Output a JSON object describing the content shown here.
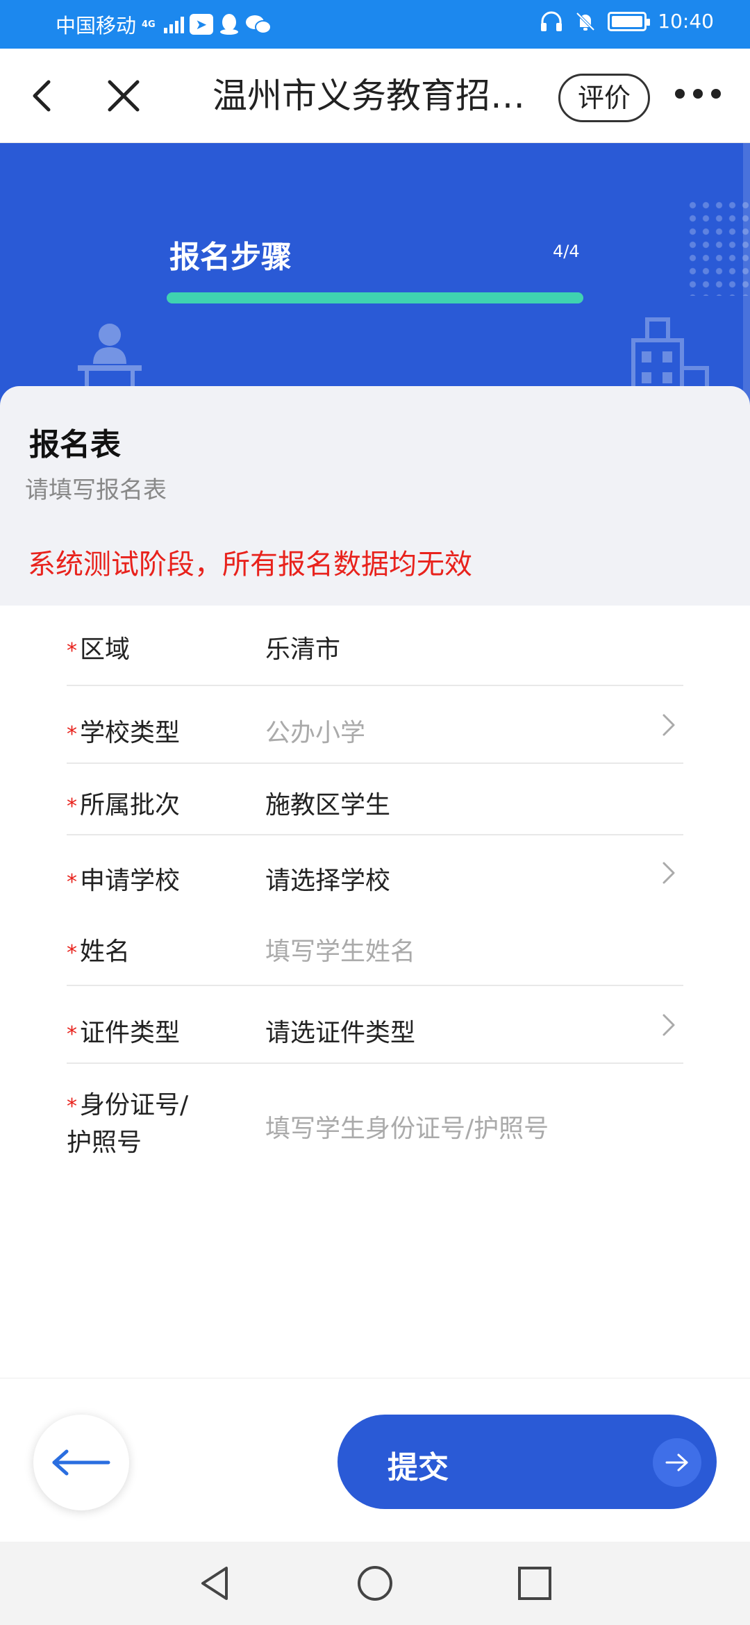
{
  "status_bar": {
    "carrier": "中国移动",
    "network": "4G",
    "time": "10:40"
  },
  "nav": {
    "title": "温州市义务教育招生报名",
    "rate_label": "评价"
  },
  "banner": {
    "step_title": "报名步骤",
    "step_count": "4/4",
    "progress": 1.0
  },
  "form_header": {
    "title": "报名表",
    "subtitle": "请填写报名表",
    "warning": "系统测试阶段，所有报名数据均无效"
  },
  "form": {
    "required_mark": "*",
    "rows": [
      {
        "label": "区域",
        "value": "乐清市",
        "placeholder": false,
        "chevron": false
      },
      {
        "label": "学校类型",
        "value": "公办小学",
        "placeholder": true,
        "chevron": true
      },
      {
        "label": "所属批次",
        "value": "施教区学生",
        "placeholder": false,
        "chevron": false
      },
      {
        "label": "申请学校",
        "value": "请选择学校",
        "placeholder": false,
        "chevron": true
      },
      {
        "label": "姓名",
        "value": "填写学生姓名",
        "placeholder": true,
        "chevron": false
      },
      {
        "label": "证件类型",
        "value": "请选证件类型",
        "placeholder": false,
        "chevron": true
      },
      {
        "label": "身份证号/护照号",
        "value": "填写学生身份证号/护照号",
        "placeholder": true,
        "chevron": false
      }
    ]
  },
  "actions": {
    "submit_label": "提交"
  },
  "colors": {
    "status_bar": "#1c88ee",
    "primary": "#2a5ad6",
    "progress": "#3fd3b0",
    "warning": "#e8221c",
    "required": "#e8221c"
  },
  "icons": {
    "back": "chevron-left-icon",
    "close": "close-icon",
    "more": "more-dots-icon",
    "row_chevron": "chevron-right-icon",
    "prev": "arrow-left-icon",
    "submit_arrow": "arrow-right-icon"
  }
}
